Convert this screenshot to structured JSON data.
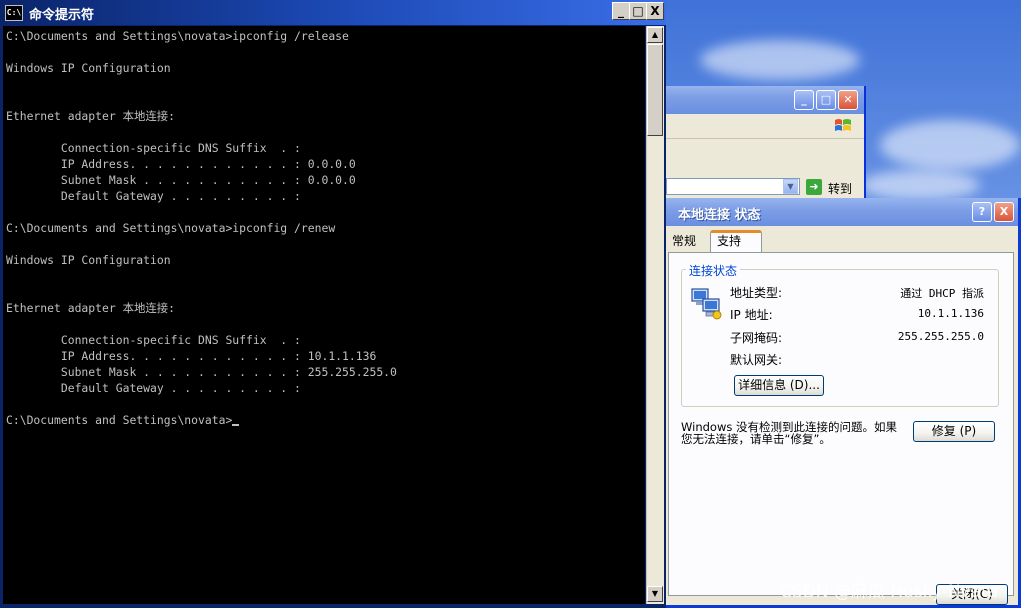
{
  "cmd_window": {
    "title": "命令提示符",
    "icon_text": "C:\\",
    "lines": [
      "C:\\Documents and Settings\\novata>ipconfig /release",
      "",
      "Windows IP Configuration",
      "",
      "",
      "Ethernet adapter 本地连接:",
      "",
      "        Connection-specific DNS Suffix  . :",
      "        IP Address. . . . . . . . . . . . : 0.0.0.0",
      "        Subnet Mask . . . . . . . . . . . : 0.0.0.0",
      "        Default Gateway . . . . . . . . . :",
      "",
      "C:\\Documents and Settings\\novata>ipconfig /renew",
      "",
      "Windows IP Configuration",
      "",
      "",
      "Ethernet adapter 本地连接:",
      "",
      "        Connection-specific DNS Suffix  . :",
      "        IP Address. . . . . . . . . . . . : 10.1.1.136",
      "        Subnet Mask . . . . . . . . . . . : 255.255.255.0",
      "        Default Gateway . . . . . . . . . :",
      ""
    ],
    "prompt": "C:\\Documents and Settings\\novata>",
    "buttons": {
      "minimize": "_",
      "maximize": "□",
      "close": "X"
    }
  },
  "explorer_window": {
    "go_label": "转到",
    "icons": [
      "minimize-icon",
      "maximize-icon",
      "close-icon",
      "windows-logo-icon",
      "go-arrow-icon"
    ]
  },
  "status_dialog": {
    "title": "本地连接 状态",
    "help_button": "?",
    "close_button": "X",
    "tabs": [
      {
        "label": "常规",
        "active": false
      },
      {
        "label": "支持",
        "active": true
      }
    ],
    "group_title": "连接状态",
    "fields": [
      {
        "label": "地址类型:",
        "value": "通过 DHCP 指派"
      },
      {
        "label": "IP 地址:",
        "value": "10.1.1.136"
      },
      {
        "label": "子网掩码:",
        "value": "255.255.255.0"
      },
      {
        "label": "默认网关:",
        "value": ""
      }
    ],
    "details_button": "详细信息 (D)...",
    "message": "Windows 没有检测到此连接的问题。如果您无法连接，请单击“修复”。",
    "repair_button": "修复 (P)",
    "close_dialog_button": "关闭(C)",
    "accent_color": "#0046d5"
  },
  "watermark": "CSDN @麻瓜 Husky-Nvata"
}
